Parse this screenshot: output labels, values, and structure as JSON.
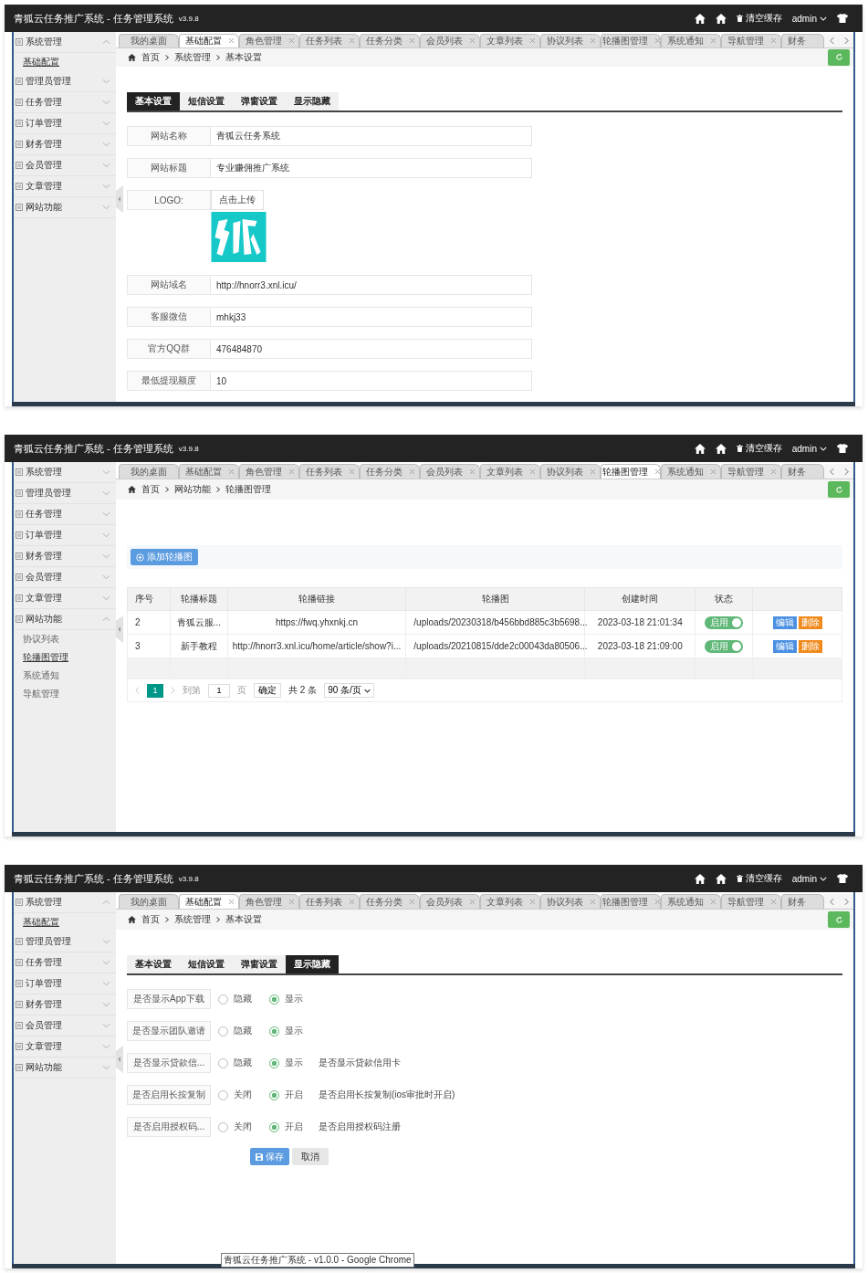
{
  "panels": [
    {
      "header": {
        "title": "青狐云任务推广系统 - 任务管理系统",
        "version": "v3.9.8",
        "clear_cache": "清空缓存",
        "user": "admin"
      },
      "tabs": [
        {
          "label": "我的桌面",
          "selected": false,
          "closable": false
        },
        {
          "label": "基础配置",
          "selected": true,
          "closable": true
        },
        {
          "label": "角色管理",
          "selected": false,
          "closable": true
        },
        {
          "label": "任务列表",
          "selected": false,
          "closable": true
        },
        {
          "label": "任务分类",
          "selected": false,
          "closable": true
        },
        {
          "label": "会员列表",
          "selected": false,
          "closable": true
        },
        {
          "label": "文章列表",
          "selected": false,
          "closable": true
        },
        {
          "label": "协议列表",
          "selected": false,
          "closable": true
        },
        {
          "label": "轮播图管理",
          "selected": false,
          "closable": true
        },
        {
          "label": "系统通知",
          "selected": false,
          "closable": true
        },
        {
          "label": "导航管理",
          "selected": false,
          "closable": true
        },
        {
          "label": "财务",
          "selected": false,
          "closable": false
        }
      ],
      "sidebar": [
        {
          "label": "系统管理",
          "expanded": true,
          "children": [
            {
              "label": "基础配置",
              "selected": true
            }
          ]
        },
        {
          "label": "管理员管理",
          "expanded": false
        },
        {
          "label": "任务管理",
          "expanded": false
        },
        {
          "label": "订单管理",
          "expanded": false
        },
        {
          "label": "财务管理",
          "expanded": false
        },
        {
          "label": "会员管理",
          "expanded": false
        },
        {
          "label": "文章管理",
          "expanded": false
        },
        {
          "label": "网站功能",
          "expanded": false
        }
      ],
      "breadcrumb": [
        "首页",
        "系统管理",
        "基本设置"
      ],
      "content": {
        "kind": "form",
        "subtabs": [
          {
            "label": "基本设置",
            "selected": true
          },
          {
            "label": "短信设置",
            "selected": false
          },
          {
            "label": "弹窗设置",
            "selected": false
          },
          {
            "label": "显示隐藏",
            "selected": false
          }
        ],
        "fields": [
          {
            "kind": "text",
            "label": "网站名称",
            "value": "青狐云任务系统"
          },
          {
            "kind": "text",
            "label": "网站标题",
            "value": "专业赚佣推广系统"
          },
          {
            "kind": "upload",
            "label": "LOGO:",
            "button": "点击上传"
          },
          {
            "kind": "text",
            "label": "网站域名",
            "value": "http://hnorr3.xnl.icu/"
          },
          {
            "kind": "text",
            "label": "客服微信",
            "value": "mhkj33"
          },
          {
            "kind": "text",
            "label": "官方QQ群",
            "value": "476484870"
          },
          {
            "kind": "text",
            "label": "最低提现额度",
            "value": "10"
          }
        ]
      }
    },
    {
      "header": {
        "title": "青狐云任务推广系统 - 任务管理系统",
        "version": "v3.9.8",
        "clear_cache": "清空缓存",
        "user": "admin"
      },
      "tabs": [
        {
          "label": "我的桌面",
          "selected": false,
          "closable": false
        },
        {
          "label": "基础配置",
          "selected": false,
          "closable": true
        },
        {
          "label": "角色管理",
          "selected": false,
          "closable": true
        },
        {
          "label": "任务列表",
          "selected": false,
          "closable": true
        },
        {
          "label": "任务分类",
          "selected": false,
          "closable": true
        },
        {
          "label": "会员列表",
          "selected": false,
          "closable": true
        },
        {
          "label": "文章列表",
          "selected": false,
          "closable": true
        },
        {
          "label": "协议列表",
          "selected": false,
          "closable": true
        },
        {
          "label": "轮播图管理",
          "selected": true,
          "closable": true
        },
        {
          "label": "系统通知",
          "selected": false,
          "closable": true
        },
        {
          "label": "导航管理",
          "selected": false,
          "closable": true
        },
        {
          "label": "财务",
          "selected": false,
          "closable": false
        }
      ],
      "sidebar": [
        {
          "label": "系统管理",
          "expanded": false
        },
        {
          "label": "管理员管理",
          "expanded": false
        },
        {
          "label": "任务管理",
          "expanded": false
        },
        {
          "label": "订单管理",
          "expanded": false
        },
        {
          "label": "财务管理",
          "expanded": false
        },
        {
          "label": "会员管理",
          "expanded": false
        },
        {
          "label": "文章管理",
          "expanded": false
        },
        {
          "label": "网站功能",
          "expanded": true,
          "children": [
            {
              "label": "协议列表",
              "selected": false
            },
            {
              "label": "轮播图管理",
              "selected": true
            },
            {
              "label": "系统通知",
              "selected": false
            },
            {
              "label": "导航管理",
              "selected": false
            }
          ]
        }
      ],
      "breadcrumb": [
        "首页",
        "网站功能",
        "轮播图管理"
      ],
      "content": {
        "kind": "table",
        "add_button": "添加轮播图",
        "columns": [
          "序号",
          "轮播标题",
          "轮播链接",
          "轮播图",
          "创建时间",
          "状态"
        ],
        "rows": [
          {
            "cells": [
              "2",
              "青狐云服...",
              "https://fwq.yhxnkj.cn",
              "/uploads/20230318/b456bbd885c3b5698...",
              "2023-03-18 21:01:34"
            ],
            "status": {
              "label": "启用",
              "on": true
            },
            "actions": [
              "编辑",
              "删除"
            ]
          },
          {
            "cells": [
              "3",
              "新手教程",
              "http://hnorr3.xnl.icu/home/article/show?i...",
              "/uploads/20210815/dde2c00043da80506...",
              "2023-03-18 21:09:00"
            ],
            "status": {
              "label": "启用",
              "on": true
            },
            "actions": [
              "编辑",
              "删除"
            ]
          }
        ],
        "pagination": {
          "current": "1",
          "goto": "到第",
          "page_input": "1",
          "page_unit": "页",
          "confirm": "确定",
          "total": "共 2 条",
          "page_size": "90 条/页"
        }
      }
    },
    {
      "header": {
        "title": "青狐云任务推广系统 - 任务管理系统",
        "version": "v3.9.8",
        "clear_cache": "清空缓存",
        "user": "admin"
      },
      "tabs": [
        {
          "label": "我的桌面",
          "selected": false,
          "closable": false
        },
        {
          "label": "基础配置",
          "selected": true,
          "closable": true
        },
        {
          "label": "角色管理",
          "selected": false,
          "closable": true
        },
        {
          "label": "任务列表",
          "selected": false,
          "closable": true
        },
        {
          "label": "任务分类",
          "selected": false,
          "closable": true
        },
        {
          "label": "会员列表",
          "selected": false,
          "closable": true
        },
        {
          "label": "文章列表",
          "selected": false,
          "closable": true
        },
        {
          "label": "协议列表",
          "selected": false,
          "closable": true
        },
        {
          "label": "轮播图管理",
          "selected": false,
          "closable": true
        },
        {
          "label": "系统通知",
          "selected": false,
          "closable": true
        },
        {
          "label": "导航管理",
          "selected": false,
          "closable": true
        },
        {
          "label": "财务",
          "selected": false,
          "closable": false
        }
      ],
      "sidebar": [
        {
          "label": "系统管理",
          "expanded": true,
          "children": [
            {
              "label": "基础配置",
              "selected": true
            }
          ]
        },
        {
          "label": "管理员管理",
          "expanded": false
        },
        {
          "label": "任务管理",
          "expanded": false
        },
        {
          "label": "订单管理",
          "expanded": false
        },
        {
          "label": "财务管理",
          "expanded": false
        },
        {
          "label": "会员管理",
          "expanded": false
        },
        {
          "label": "文章管理",
          "expanded": false
        },
        {
          "label": "网站功能",
          "expanded": false
        }
      ],
      "breadcrumb": [
        "首页",
        "系统管理",
        "基本设置"
      ],
      "content": {
        "kind": "switches",
        "subtabs": [
          {
            "label": "基本设置",
            "selected": false
          },
          {
            "label": "短信设置",
            "selected": false
          },
          {
            "label": "弹窗设置",
            "selected": false
          },
          {
            "label": "显示隐藏",
            "selected": true
          }
        ],
        "rows": [
          {
            "label": "是否显示App下载",
            "options": [
              {
                "label": "隐藏",
                "selected": false
              },
              {
                "label": "显示",
                "selected": true
              }
            ]
          },
          {
            "label": "是否显示团队邀请",
            "options": [
              {
                "label": "隐藏",
                "selected": false
              },
              {
                "label": "显示",
                "selected": true
              }
            ]
          },
          {
            "label": "是否显示贷款信...",
            "options": [
              {
                "label": "隐藏",
                "selected": false
              },
              {
                "label": "显示",
                "selected": true
              }
            ],
            "note": "是否显示贷款信用卡"
          },
          {
            "label": "是否启用长按复制",
            "options": [
              {
                "label": "关闭",
                "selected": false
              },
              {
                "label": "开启",
                "selected": true
              }
            ],
            "note": "是否启用长按复制(ios审批时开启)"
          },
          {
            "label": "是否启用授权码...",
            "options": [
              {
                "label": "关闭",
                "selected": false
              },
              {
                "label": "开启",
                "selected": true
              }
            ],
            "note": "是否启用授权码注册"
          }
        ],
        "save": "保存",
        "cancel": "取消"
      },
      "tooltip": "青狐云任务推广系统 - v1.0.0 - Google Chrome"
    }
  ]
}
